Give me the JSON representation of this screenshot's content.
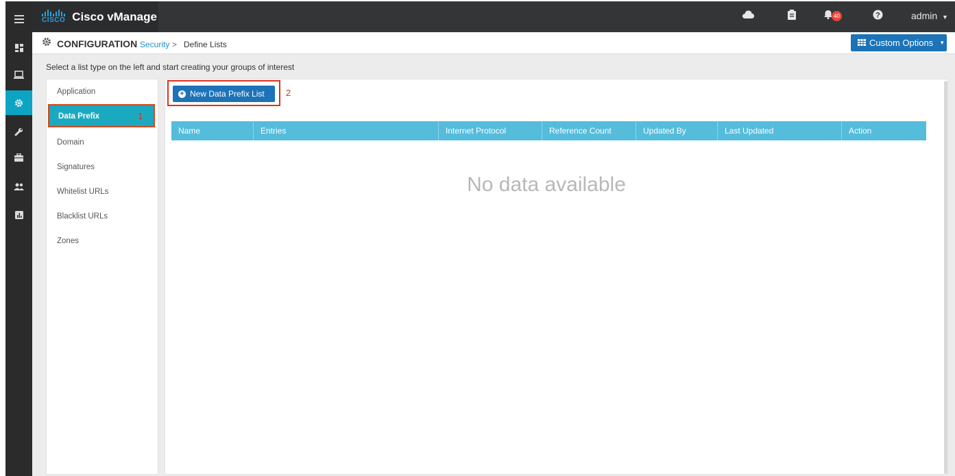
{
  "app": {
    "brand_word": "CISCO",
    "title": "Cisco vManage",
    "user": "admin",
    "notification_count": "40"
  },
  "rail": [
    {
      "icon": "hamburger-menu-icon"
    },
    {
      "icon": "dashboard-icon"
    },
    {
      "icon": "monitor-icon"
    },
    {
      "icon": "gear-icon",
      "active": true
    },
    {
      "icon": "wrench-icon"
    },
    {
      "icon": "toolbox-icon"
    },
    {
      "icon": "users-icon"
    },
    {
      "icon": "analytics-icon"
    }
  ],
  "breadcrumb": {
    "section": "CONFIGURATION",
    "link": "Security",
    "separator": ">",
    "current": "Define Lists"
  },
  "custom_options": "Custom Options",
  "instruction": "Select a list type on the left and start creating your groups of interest",
  "list_types": [
    "Application",
    "Data Prefix",
    "Domain",
    "Signatures",
    "Whitelist URLs",
    "Blacklist URLs",
    "Zones"
  ],
  "selected_list": "Data Prefix",
  "annotations": {
    "one": "1",
    "two": "2"
  },
  "new_button": "New Data Prefix List",
  "table": {
    "columns": [
      "Name",
      "Entries",
      "Internet Protocol",
      "Reference Count",
      "Updated By",
      "Last Updated",
      "Action"
    ],
    "empty_text": "No data available"
  },
  "colors": {
    "accent": "#1c73b8",
    "table_header": "#55bcdc",
    "selected_item": "#1ba9c0",
    "annotation": "#d9311f"
  }
}
